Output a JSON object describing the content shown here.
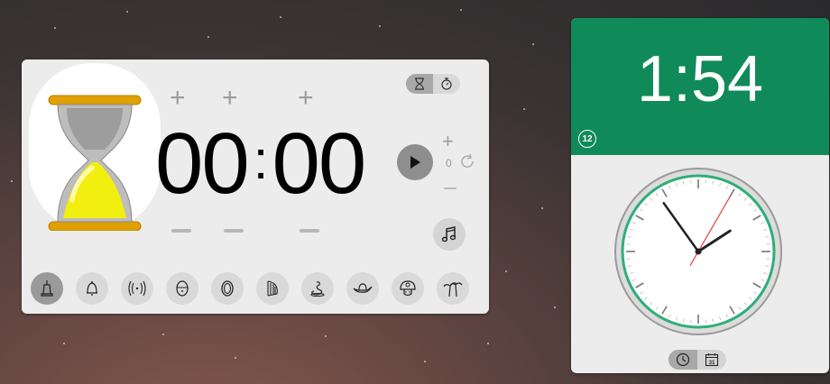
{
  "timer": {
    "hours": "00",
    "colon": ":",
    "minutes": "00",
    "repeat_count": "0",
    "mode_toggle": [
      {
        "name": "hourglass-timer-mode",
        "icon": "hourglass-icon",
        "active": true
      },
      {
        "name": "stopwatch-mode",
        "icon": "stopwatch-icon",
        "active": false
      }
    ],
    "sounds": [
      {
        "name": "hand-bell",
        "icon": "hand-bell-icon",
        "selected": true
      },
      {
        "name": "bell",
        "icon": "bell-icon",
        "selected": false
      },
      {
        "name": "vibrate",
        "icon": "vibrate-icon",
        "selected": false
      },
      {
        "name": "kitchen-timer",
        "icon": "kitchen-timer-icon",
        "selected": false
      },
      {
        "name": "gong",
        "icon": "gong-icon",
        "selected": false
      },
      {
        "name": "harp",
        "icon": "harp-icon",
        "selected": false
      },
      {
        "name": "snake",
        "icon": "snake-icon",
        "selected": false
      },
      {
        "name": "cowboy-hat",
        "icon": "cowboy-hat-icon",
        "selected": false
      },
      {
        "name": "mushroom",
        "icon": "mushroom-icon",
        "selected": false
      },
      {
        "name": "palm-trees",
        "icon": "palm-trees-icon",
        "selected": false
      }
    ]
  },
  "clock": {
    "digital_time": "1:54",
    "format_badge": "12",
    "analog": {
      "hour": 1,
      "minute": 54,
      "second": 5
    },
    "view_toggle": [
      {
        "name": "analog-clock-view",
        "icon": "clock-icon",
        "active": true
      },
      {
        "name": "calendar-view",
        "icon": "calendar-icon",
        "label": "31",
        "active": false
      }
    ]
  },
  "colors": {
    "accent_green": "#0f8a58",
    "hourglass_sand": "#f2ee10",
    "hourglass_frame": "#e0a000",
    "second_hand": "#e8413a",
    "clock_ring": "#2fae78"
  }
}
